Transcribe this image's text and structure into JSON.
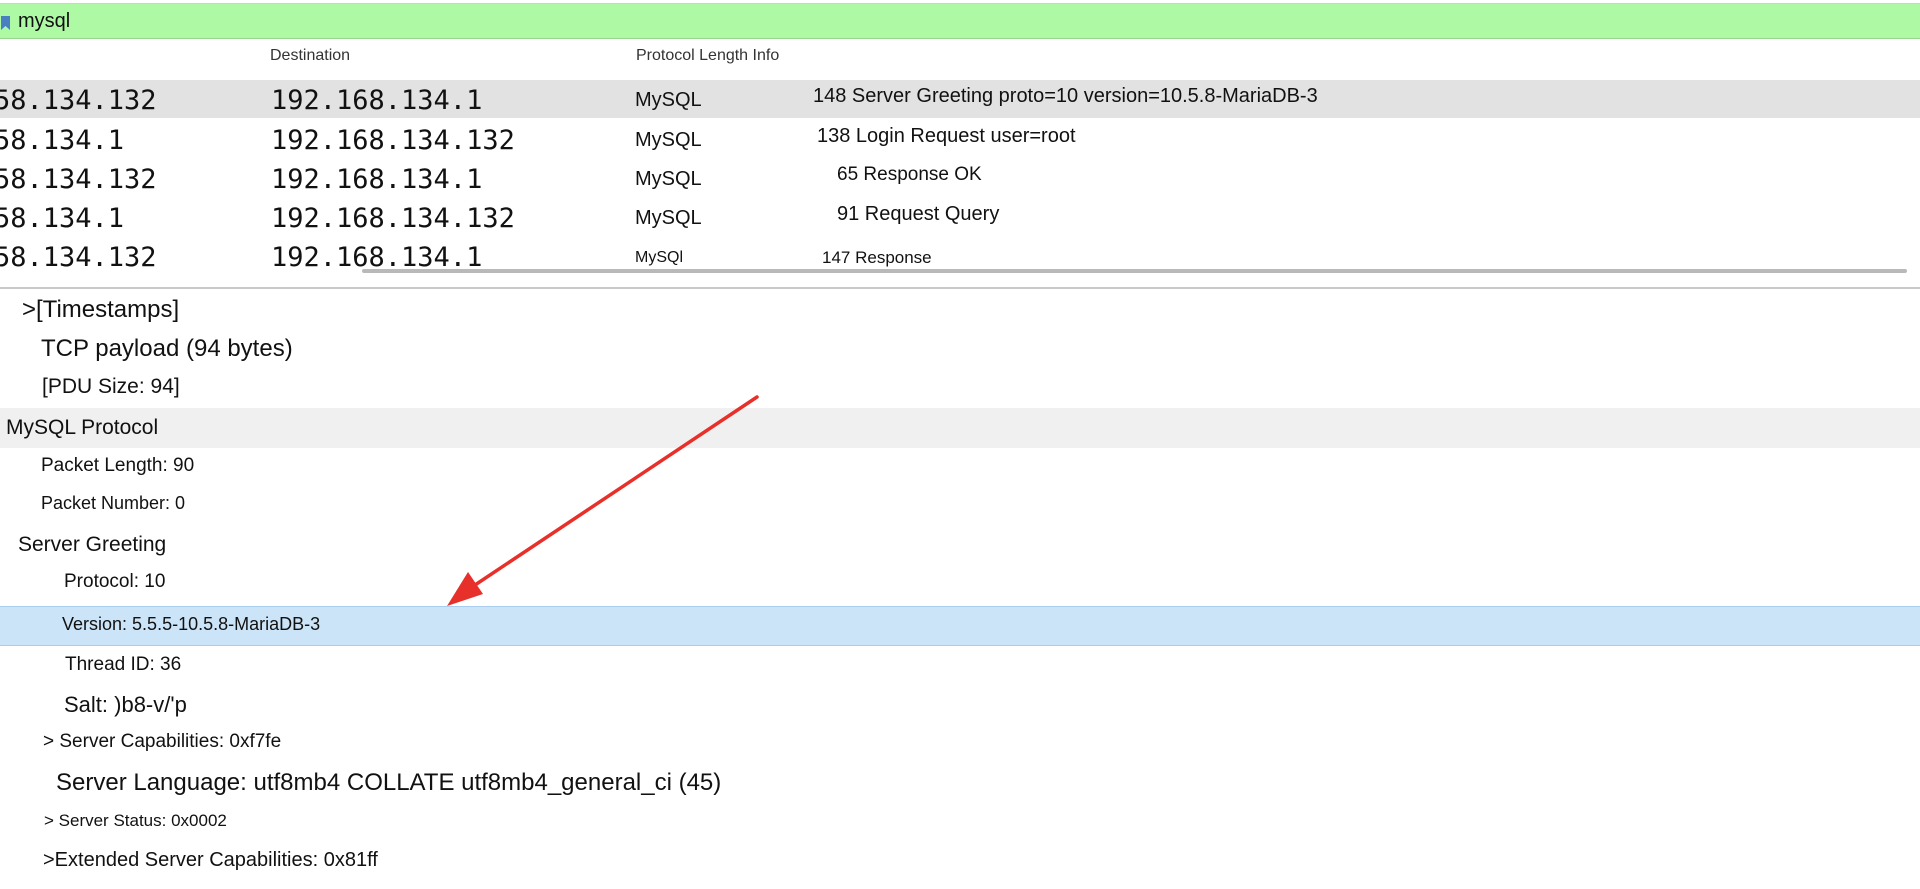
{
  "filter": {
    "value": "mysql",
    "bar_color": "#aefaa4"
  },
  "columns": {
    "destination": "Destination",
    "proto_len_info": "Protocol Length Info"
  },
  "packets": [
    {
      "source": "58.134.132",
      "destination": "192.168.134.1",
      "protocol": "MySQL",
      "info": "148 Server Greeting proto=10 version=10.5.8-MariaDB-3"
    },
    {
      "source": "58.134.1",
      "destination": "192.168.134.132",
      "protocol": "MySQL",
      "info": "138 Login Request user=root"
    },
    {
      "source": "58.134.132",
      "destination": "192.168.134.1",
      "protocol": "MySQL",
      "info": "65 Response OK"
    },
    {
      "source": "58.134.1",
      "destination": "192.168.134.132",
      "protocol": "MySQL",
      "info": "91 Request Query"
    },
    {
      "source": "58.134.132",
      "destination": "192.168.134.1",
      "protocol": "MySQl",
      "info": "147 Response"
    }
  ],
  "details": {
    "timestamps": ">[Timestamps]",
    "tcp_payload": "TCP payload (94 bytes)",
    "pdu_size": "[PDU Size: 94]",
    "mysql_protocol": "MySQL Protocol",
    "packet_length": "Packet Length: 90",
    "packet_number": "Packet Number: 0",
    "server_greeting": "Server Greeting",
    "protocol": "Protocol: 10",
    "version": "Version: 5.5.5-10.5.8-MariaDB-3",
    "thread_id": "Thread ID: 36",
    "salt": "Salt: )b8-v/'p",
    "server_capabilities": "> Server Capabilities:  0xf7fe",
    "server_language": "Server Language: utf8mb4 COLLATE utf8mb4_general_ci (45)",
    "server_status": "> Server Status:  0x0002",
    "extended_capabilities": ">Extended Server Capabilities:  0x81ff"
  },
  "colors": {
    "selected_row": "#e2e2e2",
    "highlight_row": "#cce4f7",
    "arrow": "#e8302a"
  },
  "icons": {
    "filter_bookmark": "bookmark-icon",
    "annotation": "red-arrow-annotation"
  }
}
